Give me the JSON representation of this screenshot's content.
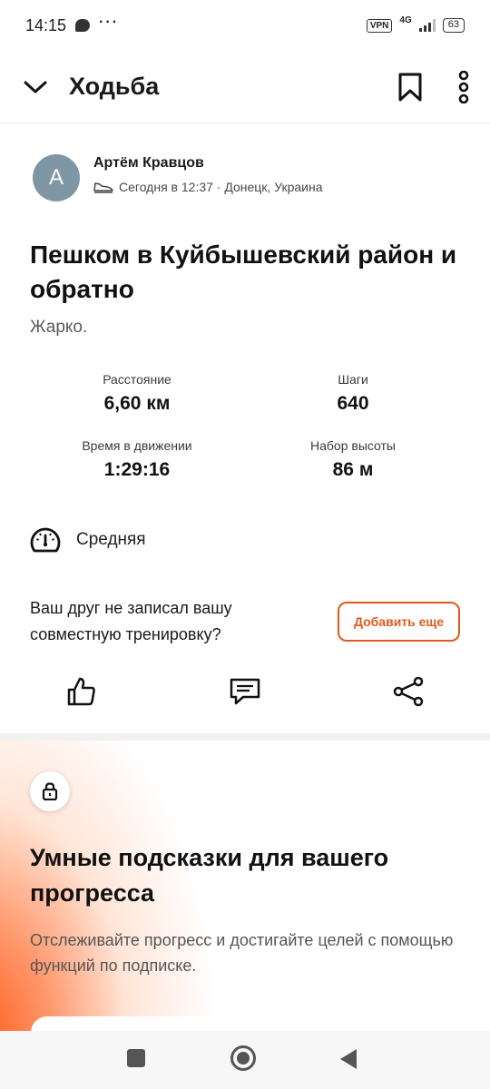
{
  "status_bar": {
    "time": "14:15",
    "more": "···",
    "vpn": "VPN",
    "network": "4G",
    "battery": "63"
  },
  "header": {
    "title": "Ходьба"
  },
  "author": {
    "initial": "A",
    "name": "Артём Кравцов",
    "meta": "Сегодня в 12:37 · Донецк, Украина"
  },
  "activity": {
    "title": "Пешком в Куйбышевский район и обратно",
    "description": "Жарко."
  },
  "stats": [
    {
      "label": "Расстояние",
      "value": "6,60 км"
    },
    {
      "label": "Шаги",
      "value": "640"
    },
    {
      "label": "Время в движении",
      "value": "1:29:16"
    },
    {
      "label": "Набор высоты",
      "value": "86 м"
    }
  ],
  "effort": {
    "label": "Средняя"
  },
  "friend": {
    "text": "Ваш друг не записал вашу совместную тренировку?",
    "button": "Добавить еще"
  },
  "promo": {
    "title": "Умные подсказки для вашего прогресса",
    "text": "Отслеживайте прогресс и достигайте целей с помощью функций по подписке."
  },
  "colors": {
    "accent": "#e05a1c",
    "avatar": "#7f96a4",
    "promo_gradient": "#ff5614"
  },
  "icons": [
    "chevron-down-icon",
    "bookmark-icon",
    "more-vertical-icon",
    "shoe-icon",
    "speedometer-icon",
    "thumbs-up-icon",
    "comment-icon",
    "share-icon",
    "lock-icon"
  ]
}
